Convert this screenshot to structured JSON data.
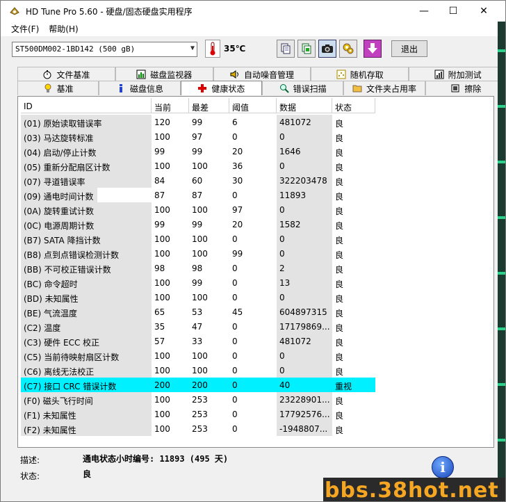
{
  "window": {
    "title": "HD Tune Pro 5.60 - 硬盘/固态硬盘实用程序"
  },
  "menu": {
    "file": "文件(F)",
    "help": "帮助(H)"
  },
  "toolbar": {
    "drive": "ST500DM002-1BD142 (500 gB)",
    "temperature": "35℃",
    "exit_label": "退出"
  },
  "tabs_row1": [
    "文件基准",
    "磁盘监视器",
    "自动噪音管理",
    "随机存取",
    "附加测试"
  ],
  "tabs_row2": [
    "基准",
    "磁盘信息",
    "健康状态",
    "错误扫描",
    "文件夹占用率",
    "擦除"
  ],
  "active_tab": "健康状态",
  "columns": [
    "ID",
    "当前",
    "最差",
    "阈值",
    "数据",
    "状态"
  ],
  "rows": [
    [
      "(01) 原始读取错误率",
      "120",
      "99",
      "6",
      "481072",
      "良"
    ],
    [
      "(03) 马达旋转标准",
      "100",
      "97",
      "0",
      "0",
      "良"
    ],
    [
      "(04) 启动/停止计数",
      "99",
      "99",
      "20",
      "1646",
      "良"
    ],
    [
      "(05) 重新分配扇区计数",
      "100",
      "100",
      "36",
      "0",
      "良"
    ],
    [
      "(07) 寻道错误率",
      "84",
      "60",
      "30",
      "322203478",
      "良"
    ],
    [
      "(09) 通电时间计数",
      "87",
      "87",
      "0",
      "11893",
      "良"
    ],
    [
      "(0A) 旋转重试计数",
      "100",
      "100",
      "97",
      "0",
      "良"
    ],
    [
      "(0C) 电源周期计数",
      "99",
      "99",
      "20",
      "1582",
      "良"
    ],
    [
      "(B7) SATA 降挡计数",
      "100",
      "100",
      "0",
      "0",
      "良"
    ],
    [
      "(B8) 点到点错误检测计数",
      "100",
      "100",
      "99",
      "0",
      "良"
    ],
    [
      "(BB) 不可校正错误计数",
      "98",
      "98",
      "0",
      "2",
      "良"
    ],
    [
      "(BC) 命令超时",
      "100",
      "99",
      "0",
      "13",
      "良"
    ],
    [
      "(BD) 未知属性",
      "100",
      "100",
      "0",
      "0",
      "良"
    ],
    [
      "(BE) 气流温度",
      "65",
      "53",
      "45",
      "604897315",
      "良"
    ],
    [
      "(C2) 温度",
      "35",
      "47",
      "0",
      "17179869...",
      "良"
    ],
    [
      "(C3) 硬件 ECC 校正",
      "57",
      "33",
      "0",
      "481072",
      "良"
    ],
    [
      "(C5) 当前待映射扇区计数",
      "100",
      "100",
      "0",
      "0",
      "良"
    ],
    [
      "(C6) 离线无法校正",
      "100",
      "100",
      "0",
      "0",
      "良"
    ],
    [
      "(C7) 接口 CRC 错误计数",
      "200",
      "200",
      "0",
      "40",
      "重视"
    ],
    [
      "(F0) 磁头飞行时间",
      "100",
      "253",
      "0",
      "23228901...",
      "良"
    ],
    [
      "(F1) 未知属性",
      "100",
      "253",
      "0",
      "17792576...",
      "良"
    ],
    [
      "(F2) 未知属性",
      "100",
      "253",
      "0",
      "-1948807...",
      "良"
    ]
  ],
  "highlight_row": 18,
  "footer": {
    "desc_label": "描述:",
    "desc_value": "通电状态小时编号: 11893 (495 天)",
    "status_label": "状态:",
    "status_value": "良"
  },
  "watermark": "bbs.38hot.net",
  "colors": {
    "highlight": "#00f0ff",
    "watermark_text": "#f5a623"
  }
}
